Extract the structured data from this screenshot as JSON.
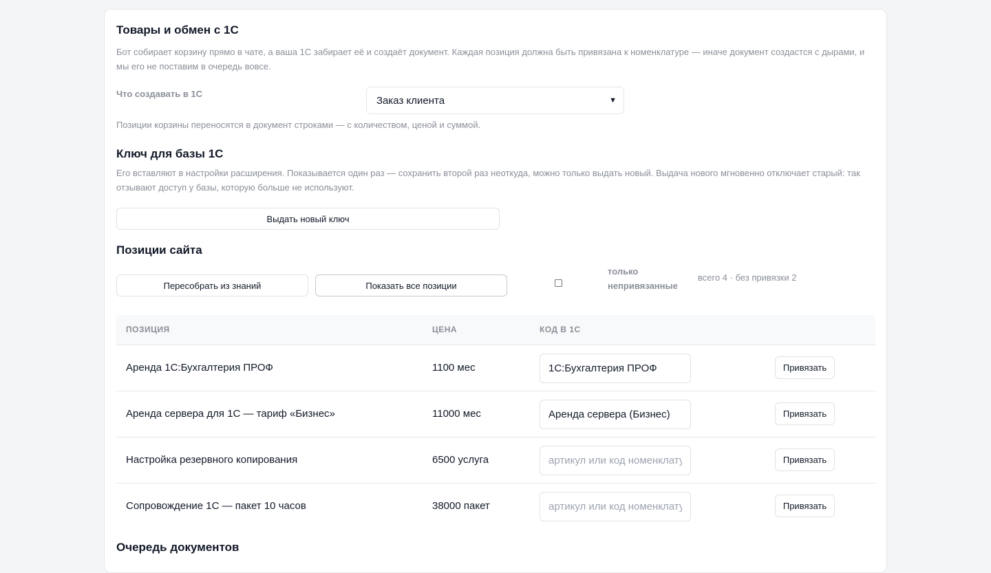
{
  "goods": {
    "title": "Товары и обмен с 1С",
    "description": "Бот собирает корзину прямо в чате, а ваша 1С забирает её и создаёт документ. Каждая позиция должна быть привязана к номенклатуре — иначе документ создастся с дырами, и мы его не поставим в очередь вовсе.",
    "create_label": "Что создавать в 1С",
    "create_select_value": "Заказ клиента",
    "rows_note": "Позиции корзины переносятся в документ строками — с количеством, ценой и суммой."
  },
  "key": {
    "title": "Ключ для базы 1С",
    "description": "Его вставляют в настройки расширения. Показывается один раз — сохранить второй раз неоткуда, можно только выдать новый. Выдача нового мгновенно отключает старый: так отзывают доступ у базы, которую больше не используют.",
    "issue_button": "Выдать новый ключ"
  },
  "positions": {
    "title": "Позиции сайта",
    "rebuild_button": "Пересобрать из знаний",
    "show_all_button": "Показать все позиции",
    "only_unbound_label": "только непривязанные",
    "only_unbound_checked": false,
    "counts": "всего 4 · без привязки 2",
    "columns": {
      "position": "ПОЗИЦИЯ",
      "price": "ЦЕНА",
      "code": "КОД В 1С"
    },
    "rows": [
      {
        "name": "Аренда 1С:Бухгалтерия ПРОФ",
        "price": "1100 мес",
        "code": "1С:Бухгалтерия ПРОФ",
        "placeholder": "артикул или код номенклатуры",
        "action": "Привязать"
      },
      {
        "name": "Аренда сервера для 1С — тариф «Бизнес»",
        "price": "11000 мес",
        "code": "Аренда сервера (Бизнес)",
        "placeholder": "артикул или код номенклатуры",
        "action": "Привязать"
      },
      {
        "name": "Настройка резервного копирования",
        "price": "6500 услуга",
        "code": "",
        "placeholder": "артикул или код номенклатуры",
        "action": "Привязать"
      },
      {
        "name": "Сопровождение 1С — пакет 10 часов",
        "price": "38000 пакет",
        "code": "",
        "placeholder": "артикул или код номенклатуры",
        "action": "Привязать"
      }
    ]
  },
  "queue": {
    "title": "Очередь документов"
  }
}
